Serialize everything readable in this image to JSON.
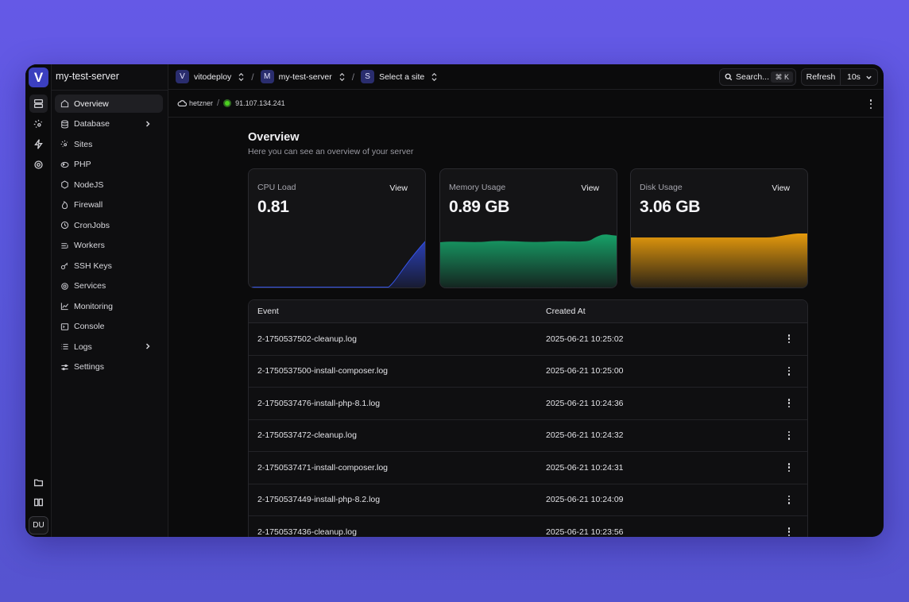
{
  "app": {
    "logo_letter": "V",
    "server_name": "my-test-server",
    "user_initials": "DU"
  },
  "rail": {
    "icons": [
      "servers-icon",
      "sites-icon",
      "flash-icon",
      "settings-icon",
      "folder-icon",
      "book-icon"
    ]
  },
  "sidebar": {
    "items": [
      {
        "label": "Overview",
        "icon": "home-icon",
        "active": true
      },
      {
        "label": "Database",
        "icon": "database-icon",
        "has_submenu": true
      },
      {
        "label": "Sites",
        "icon": "sites-icon"
      },
      {
        "label": "PHP",
        "icon": "php-icon"
      },
      {
        "label": "NodeJS",
        "icon": "nodejs-icon"
      },
      {
        "label": "Firewall",
        "icon": "flame-icon"
      },
      {
        "label": "CronJobs",
        "icon": "clock-icon"
      },
      {
        "label": "Workers",
        "icon": "workers-icon"
      },
      {
        "label": "SSH Keys",
        "icon": "key-icon"
      },
      {
        "label": "Services",
        "icon": "gear-icon"
      },
      {
        "label": "Monitoring",
        "icon": "chart-icon"
      },
      {
        "label": "Console",
        "icon": "terminal-icon"
      },
      {
        "label": "Logs",
        "icon": "list-icon",
        "has_submenu": true
      },
      {
        "label": "Settings",
        "icon": "sliders-icon"
      }
    ]
  },
  "topbar": {
    "project": {
      "badge": "V",
      "label": "vitodeploy"
    },
    "server": {
      "badge": "M",
      "label": "my-test-server"
    },
    "site": {
      "badge": "S",
      "label": "Select a site"
    },
    "search_label": "Search...",
    "search_shortcut": "⌘ K",
    "refresh_label": "Refresh",
    "interval_value": "10s"
  },
  "subbar": {
    "provider": "hetzner",
    "ip": "91.107.134.241",
    "status_color": "#4cd11f"
  },
  "main": {
    "title": "Overview",
    "subtitle": "Here you can see an overview of your server",
    "view_label": "View",
    "cards": [
      {
        "label": "CPU Load",
        "value": "0.81",
        "color": "#2f48d6"
      },
      {
        "label": "Memory Usage",
        "value": "0.89 GB",
        "color": "#16a36b"
      },
      {
        "label": "Disk Usage",
        "value": "3.06 GB",
        "color": "#f0a10c"
      }
    ]
  },
  "table": {
    "headers": {
      "event": "Event",
      "created_at": "Created At"
    },
    "rows": [
      {
        "event": "2-1750537502-cleanup.log",
        "created_at": "2025-06-21 10:25:02"
      },
      {
        "event": "2-1750537500-install-composer.log",
        "created_at": "2025-06-21 10:25:00"
      },
      {
        "event": "2-1750537476-install-php-8.1.log",
        "created_at": "2025-06-21 10:24:36"
      },
      {
        "event": "2-1750537472-cleanup.log",
        "created_at": "2025-06-21 10:24:32"
      },
      {
        "event": "2-1750537471-install-composer.log",
        "created_at": "2025-06-21 10:24:31"
      },
      {
        "event": "2-1750537449-install-php-8.2.log",
        "created_at": "2025-06-21 10:24:09"
      },
      {
        "event": "2-1750537436-cleanup.log",
        "created_at": "2025-06-21 10:23:56"
      }
    ]
  }
}
